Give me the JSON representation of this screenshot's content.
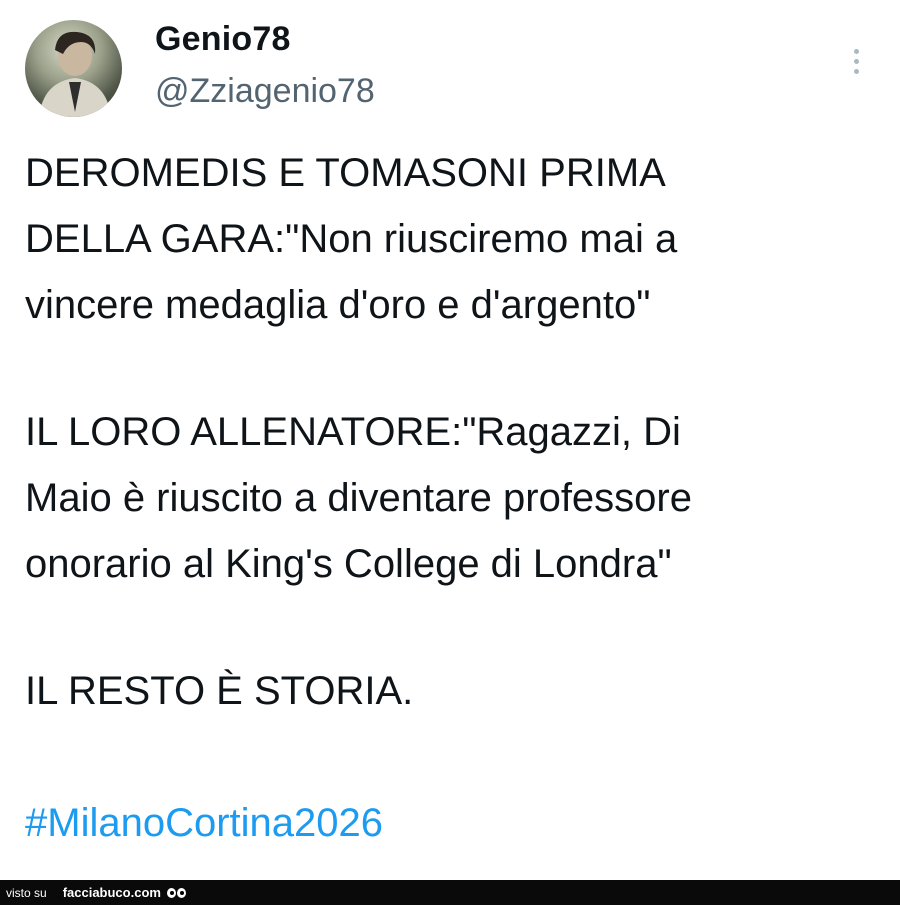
{
  "tweet": {
    "display_name": "Genio78",
    "handle": "@Zziagenio78",
    "lines": {
      "l1": "DEROMEDIS E TOMASONI PRIMA",
      "l2": "DELLA GARA:\"Non riusciremo mai a",
      "l3": "vincere medaglia d'oro e d'argento\"",
      "l4": "IL LORO ALLENATORE:\"Ragazzi, Di",
      "l5": "Maio è riuscito a diventare professore",
      "l6": "onorario al King's College di Londra\"",
      "l7": "IL RESTO È STORIA."
    },
    "hashtag": "#MilanoCortina2026",
    "hashtag_color": "#1d9bf0",
    "more_icon": "vertical-ellipsis-icon"
  },
  "footer": {
    "visto_su": "visto su",
    "site": "facciabuco.com",
    "logo_icon": "eyes-icon"
  }
}
